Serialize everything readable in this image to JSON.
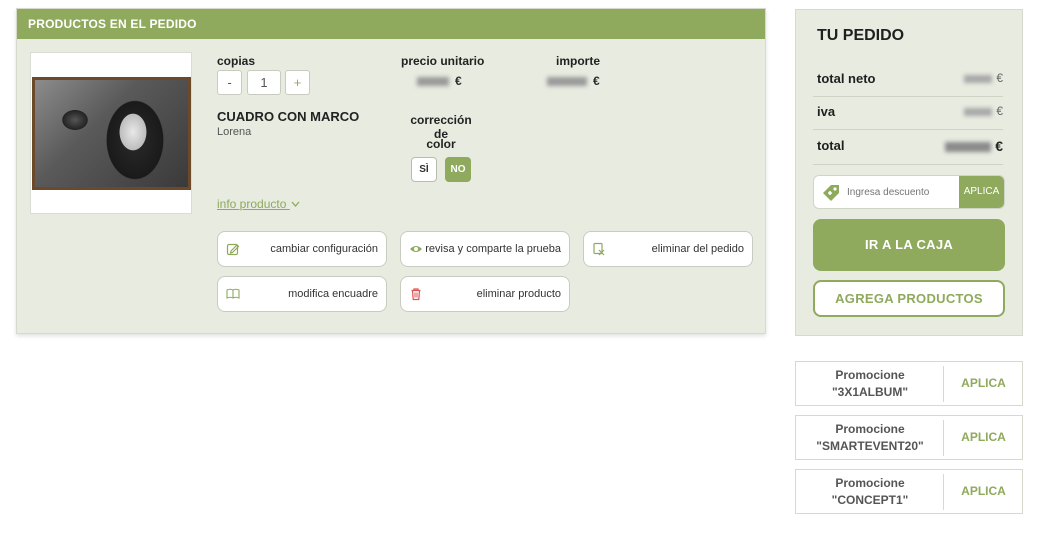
{
  "products_section": {
    "header": "PRODUCTOS EN EL PEDIDO",
    "copies_label": "copias",
    "minus_label": "-",
    "copies_value": "1",
    "plus_label": "+",
    "unit_price_label": "precio unitario",
    "unit_price_currency": "€",
    "amount_label": "importe",
    "amount_currency": "€",
    "product_name": "CUADRO CON MARCO",
    "product_owner": "Lorena",
    "color_correction_label_line1": "corrección de",
    "color_correction_label_line2": "color",
    "toggle_yes": "SÌ",
    "toggle_no": "NO",
    "info_link": "info producto",
    "actions": {
      "change_config": "cambiar configuración",
      "review_share": "revisa y comparte la prueba",
      "remove_from_order": "eliminar del pedido",
      "modify_binding": "modifica encuadre",
      "delete_product": "eliminar producto"
    }
  },
  "order_summary": {
    "title": "TU PEDIDO",
    "net_total_label": "total neto",
    "net_total_currency": "€",
    "vat_label": "iva",
    "vat_currency": "€",
    "total_label": "total",
    "total_currency": "€",
    "discount_placeholder": "Ingresa descuento",
    "discount_apply": "APLICA",
    "checkout_button": "IR A LA CAJA",
    "add_products_button": "AGREGA PRODUCTOS"
  },
  "promotions": [
    {
      "line1": "Promocione",
      "line2": "\"3X1ALBUM\"",
      "apply": "APLICA"
    },
    {
      "line1": "Promocione",
      "line2": "\"SMARTEVENT20\"",
      "apply": "APLICA"
    },
    {
      "line1": "Promocione",
      "line2": "\"CONCEPT1\"",
      "apply": "APLICA"
    }
  ],
  "colors": {
    "accent": "#8fa95d",
    "panel_bg": "#e7ebe0"
  },
  "icons": [
    "edit-icon",
    "eye-icon",
    "remove-order-icon",
    "book-icon",
    "trash-icon",
    "tag-icon",
    "chevron-down-icon"
  ]
}
